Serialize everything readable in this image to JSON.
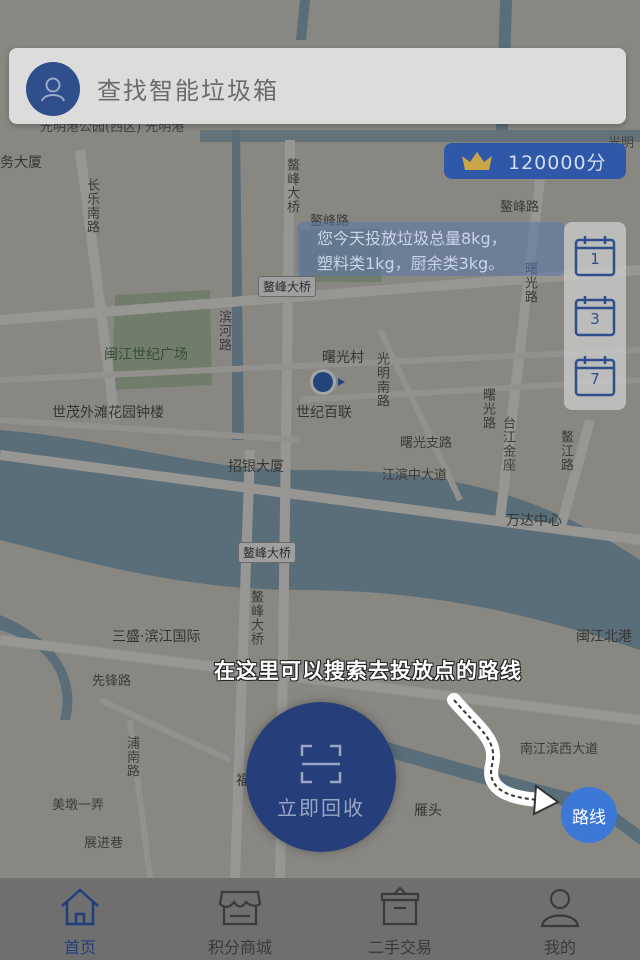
{
  "search": {
    "placeholder": "查找智能垃圾箱",
    "icon": "user-icon"
  },
  "points": {
    "value": "120000分",
    "icon": "crown-icon"
  },
  "today_summary": {
    "line1": "您今天投放垃圾总量8kg，",
    "line2": "塑料类1kg，厨余类3kg。"
  },
  "calendar": [
    {
      "label": "1",
      "icon": "calendar-icon"
    },
    {
      "label": "3",
      "icon": "calendar-icon"
    },
    {
      "label": "7",
      "icon": "calendar-icon"
    }
  ],
  "map_labels": {
    "top_partial": "光明港公园(西区)  光明港",
    "guangming": "光明",
    "wu_dasha": "务大厦",
    "changle_rd": "长乐南路",
    "aofeng_ave": "鳌峰大桥",
    "aofeng_rd_vert": "鳌峰大桥",
    "aofeng_rd": "鳌峰路",
    "aofeng_rd2": "鳌峰路",
    "aofeng_bridge": "鳌峰大桥",
    "minjiang_plaza": "闽江世纪广场",
    "binhe_rd": "滨河路",
    "shuguang_village": "曙光村",
    "shiji_bailian": "世纪百联",
    "shimao_tower": "世茂外滩花园钟楼",
    "zhaoyin": "招银大厦",
    "guangming_south": "光明南路",
    "shuguang_branch": "曙光支路",
    "jiangbin_ave": "江滨中大道",
    "shuguang_rd": "曙光路",
    "taijiang_jinzuo": "台江金座",
    "aojiang_rd": "鳌江路",
    "wanda": "万达中心",
    "shuguang_rd2": "曙光路",
    "aofeng_bridge2": "鳌峰大桥",
    "aofeng_bridge_vert": "鳌峰大桥",
    "sansheng": "三盛·滨江国际",
    "minjiang_north": "闽江北港",
    "xianfeng_rd": "先锋路",
    "nanjiang_binxi": "南江滨西大道",
    "meibo": "美墩一弄",
    "pubu_rd": "浦南路",
    "zhanjin_rd": "展进巷",
    "yantou": "雁头",
    "right_edge": "福"
  },
  "tip_text": "在这里可以搜索去投放点的路线",
  "route_button": "路线",
  "recycle_button": {
    "label": "立即回收",
    "icon": "scan-icon"
  },
  "tabs": [
    {
      "label": "首页",
      "icon": "home-icon",
      "active": true
    },
    {
      "label": "积分商城",
      "icon": "store-icon",
      "active": false
    },
    {
      "label": "二手交易",
      "icon": "box-icon",
      "active": false
    },
    {
      "label": "我的",
      "icon": "person-icon",
      "active": false
    }
  ],
  "colors": {
    "primary": "#263f7a",
    "accent_blue": "#3c79d6",
    "river": "#7fa0b3",
    "tabbar": "#6f6f6f"
  }
}
